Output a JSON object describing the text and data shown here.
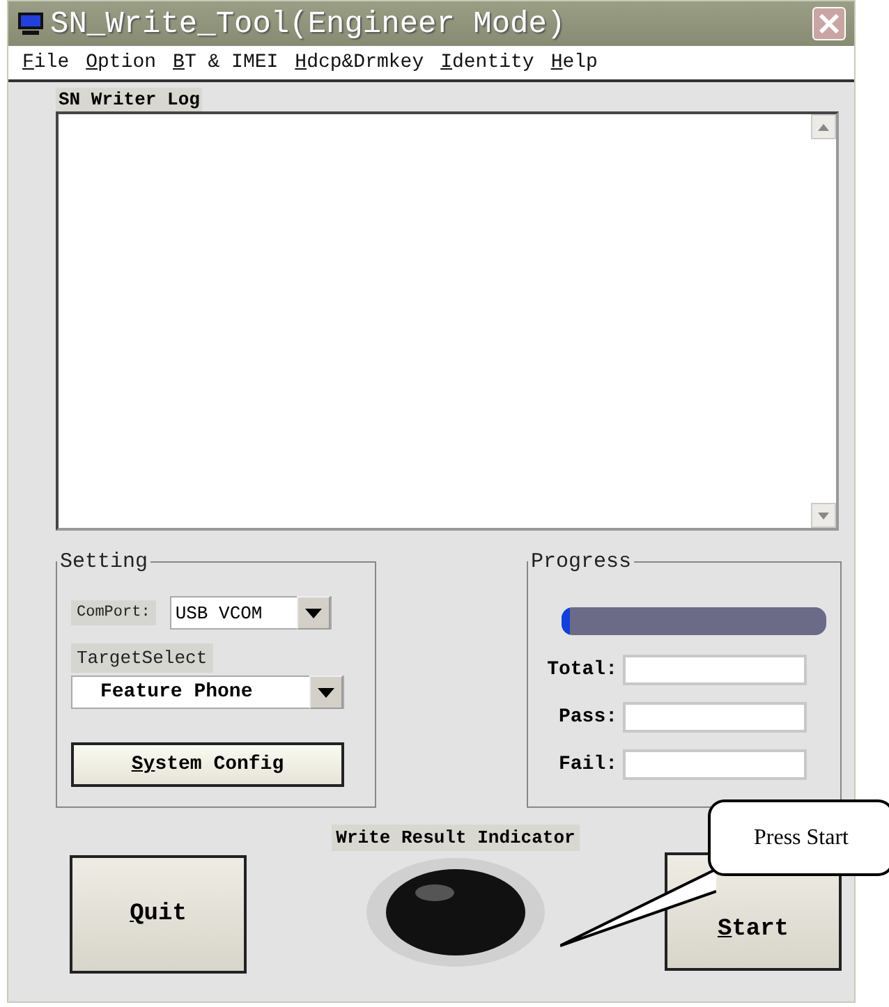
{
  "window": {
    "title": "SN_Write_Tool(Engineer Mode)"
  },
  "menu": [
    {
      "label": "File"
    },
    {
      "label": "Option"
    },
    {
      "label": "BT & IMEI"
    },
    {
      "label": "Hdcp&Drmkey"
    },
    {
      "label": "Identity"
    },
    {
      "label": "Help"
    }
  ],
  "log": {
    "title": "SN Writer Log"
  },
  "setting": {
    "title": "Setting",
    "comport_label": "ComPort:",
    "comport_value": "USB VCOM",
    "target_label": "TargetSelect",
    "target_value": "Feature Phone",
    "config_button": "System Config"
  },
  "progress": {
    "title": "Progress",
    "level": 0.02,
    "fields": [
      {
        "label": "Total:"
      },
      {
        "label": "Pass:"
      },
      {
        "label": "Fail:"
      }
    ]
  },
  "indicator": {
    "label": "Write Result Indicator"
  },
  "buttons": {
    "quit": "Quit",
    "start": "Start"
  },
  "callout": {
    "text": "Press Start"
  }
}
